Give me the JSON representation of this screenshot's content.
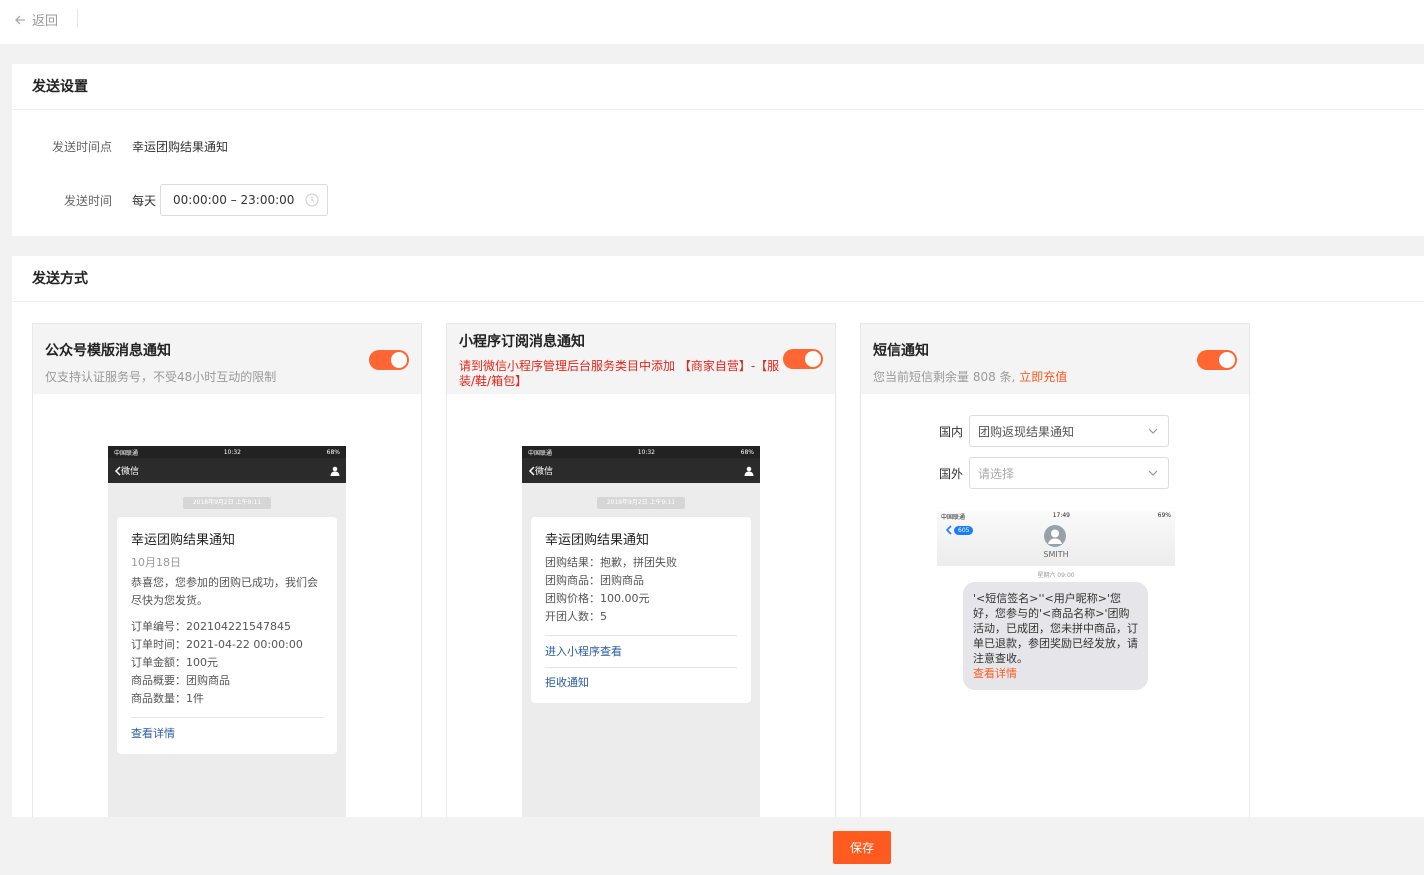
{
  "topbar": {
    "back_label": "返回"
  },
  "settings": {
    "title": "发送设置",
    "time_point_label": "发送时间点",
    "time_point_value": "幸运团购结果通知",
    "send_time_label": "发送时间",
    "send_time_prefix": "每天",
    "send_time_range": "00:00:00 – 23:00:00"
  },
  "methods": {
    "title": "发送方式",
    "wechat": {
      "title": "公众号模版消息通知",
      "desc": "仅支持认证服务号，不受48小时互动的限制",
      "enabled": true,
      "phone": {
        "carrier": "中国联通",
        "time": "10:32",
        "battery": "68%",
        "back_label": "微信",
        "date_chip": "2018年9月2日 上午9:11",
        "msg_title": "幸运团购结果通知",
        "msg_date": "10月18日",
        "msg_body": "恭喜您，您参加的团购已成功，我们会尽快为您发货。",
        "lines": [
          "订单编号：202104221547845",
          "订单时间：2021-04-22 00:00:00",
          "订单金额：100元",
          "商品概要：团购商品",
          "商品数量：1件"
        ],
        "link": "查看详情"
      }
    },
    "miniprogram": {
      "title": "小程序订阅消息通知",
      "desc": "请到微信小程序管理后台服务类目中添加 【商家自营】-【服装/鞋/箱包】",
      "enabled": true,
      "phone": {
        "carrier": "中国联通",
        "time": "10:32",
        "battery": "68%",
        "back_label": "微信",
        "date_chip": "2018年9月2日 上午9:11",
        "msg_title": "幸运团购结果通知",
        "lines": [
          "团购结果：抱歉，拼团失败",
          "团购商品：团购商品",
          "团购价格：100.00元",
          "开团人数：5"
        ],
        "link1": "进入小程序查看",
        "link2": "拒收通知"
      }
    },
    "sms": {
      "title": "短信通知",
      "desc_prefix": "您当前短信剩余量 808 条,",
      "recharge": "立即充值",
      "enabled": true,
      "domestic_label": "国内",
      "domestic_value": "团购返现结果通知",
      "foreign_label": "国外",
      "foreign_placeholder": "请选择",
      "phone": {
        "carrier": "中国联通",
        "time": "17:49",
        "battery": "69%",
        "badge": "605",
        "contact": "SMITH",
        "date": "星期六 09:00",
        "bubble": "'<短信签名>''<用户昵称>'您好，您参与的'<商品名称>'团购活动，已成团，您未拼中商品，订单已退款，参团奖励已经发放，请注意查收。",
        "link": "查看详情"
      }
    }
  },
  "save_label": "保存",
  "colors": {
    "accent": "#ff6633",
    "warning_text": "#e4261a",
    "link_blue": "#2b5d9c"
  }
}
